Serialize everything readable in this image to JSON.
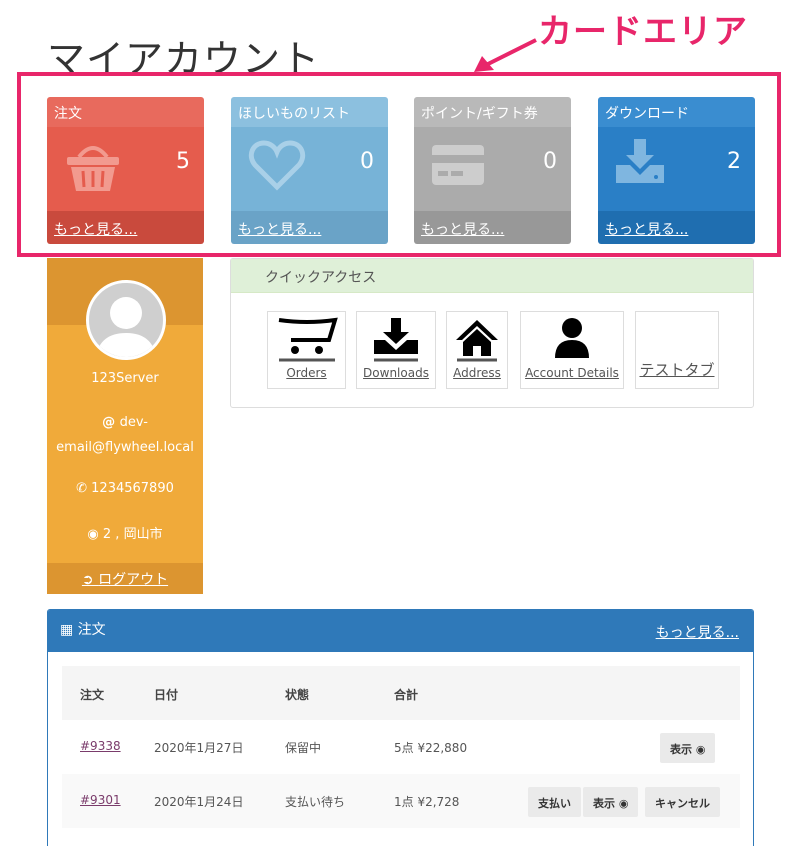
{
  "page": {
    "title": "マイアカウント"
  },
  "annotation": {
    "label": "カードエリア",
    "color": "#e8266a"
  },
  "cards": [
    {
      "label": "注文",
      "count": "5",
      "more": "もっと見る...",
      "icon": "basket-icon"
    },
    {
      "label": "ほしいものリスト",
      "count": "0",
      "more": "もっと見る...",
      "icon": "heart-icon"
    },
    {
      "label": "ポイント/ギフト券",
      "count": "0",
      "more": "もっと見る...",
      "icon": "credit-card-icon"
    },
    {
      "label": "ダウンロード",
      "count": "2",
      "more": "もっと見る...",
      "icon": "download-icon"
    }
  ],
  "profile": {
    "name": "123Server",
    "email_prefix": "dev-",
    "email_rest": "email@flywheel.local",
    "phone": "1234567890",
    "location": "2 , 岡山市",
    "logout": "ログアウト"
  },
  "quick_access": {
    "title": "クイックアクセス",
    "items": [
      "Orders",
      "Downloads",
      "Address",
      "Account Details",
      "テストタブ"
    ]
  },
  "orders": {
    "title": "注文",
    "more": "もっと見る...",
    "columns": [
      "注文",
      "日付",
      "状態",
      "合計"
    ],
    "rows": [
      {
        "number": "#9338",
        "date": "2020年1月27日",
        "status": "保留中",
        "total": "5点 ¥22,880",
        "actions": [
          "表示"
        ]
      },
      {
        "number": "#9301",
        "date": "2020年1月24日",
        "status": "支払い待ち",
        "total": "1点 ¥2,728",
        "actions": [
          "支払い",
          "表示",
          "キャンセル"
        ]
      }
    ]
  }
}
